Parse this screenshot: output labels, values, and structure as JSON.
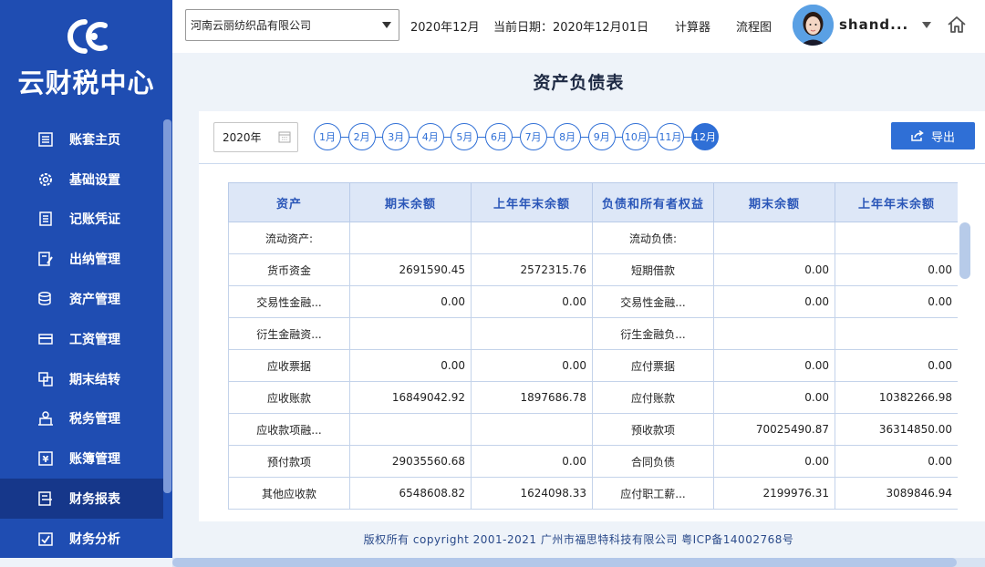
{
  "sidebar": {
    "logo_text": "云财税中心",
    "items": [
      {
        "label": "账套主页",
        "icon": "ledger-home-icon"
      },
      {
        "label": "基础设置",
        "icon": "gear-icon"
      },
      {
        "label": "记账凭证",
        "icon": "voucher-icon"
      },
      {
        "label": "出纳管理",
        "icon": "cashier-icon"
      },
      {
        "label": "资产管理",
        "icon": "assets-icon"
      },
      {
        "label": "工资管理",
        "icon": "card-icon"
      },
      {
        "label": "期末结转",
        "icon": "transfer-icon"
      },
      {
        "label": "税务管理",
        "icon": "tax-icon"
      },
      {
        "label": "账簿管理",
        "icon": "yen-icon"
      },
      {
        "label": "财务报表",
        "icon": "report-icon",
        "active": true
      },
      {
        "label": "财务分析",
        "icon": "analysis-icon"
      }
    ]
  },
  "header": {
    "company": "河南云丽纺织品有限公司",
    "period": "2020年12月",
    "current_date": "当前日期：2020年12月01日",
    "calculator": "计算器",
    "flowchart": "流程图",
    "username": "shand..."
  },
  "page_title": "资产负债表",
  "toolbar": {
    "year": "2020年",
    "months": [
      "1月",
      "2月",
      "3月",
      "4月",
      "5月",
      "6月",
      "7月",
      "8月",
      "9月",
      "10月",
      "11月",
      "12月"
    ],
    "active_month": "12月",
    "export_label": "导出"
  },
  "table": {
    "headers": [
      "资产",
      "期末余额",
      "上年年末余额",
      "负债和所有者权益",
      "期末余额",
      "上年年末余额"
    ],
    "rows": [
      [
        "流动资产:",
        "",
        "",
        "流动负债:",
        "",
        ""
      ],
      [
        "货币资金",
        "2691590.45",
        "2572315.76",
        "短期借款",
        "0.00",
        "0.00"
      ],
      [
        "交易性金融...",
        "0.00",
        "0.00",
        "交易性金融...",
        "0.00",
        "0.00"
      ],
      [
        "衍生金融资...",
        "",
        "",
        "衍生金融负...",
        "",
        ""
      ],
      [
        "应收票据",
        "0.00",
        "0.00",
        "应付票据",
        "0.00",
        "0.00"
      ],
      [
        "应收账款",
        "16849042.92",
        "1897686.78",
        "应付账款",
        "0.00",
        "10382266.98"
      ],
      [
        "应收款项融...",
        "",
        "",
        "预收款项",
        "70025490.87",
        "36314850.00"
      ],
      [
        "预付款项",
        "29035560.68",
        "0.00",
        "合同负债",
        "0.00",
        "0.00"
      ],
      [
        "其他应收款",
        "6548608.82",
        "1624098.33",
        "应付职工薪...",
        "2199976.31",
        "3089846.94"
      ]
    ]
  },
  "footer": "版权所有  copyright   2001-2021  广州市福思特科技有限公司  粤ICP备14002768号",
  "colors": {
    "sidebar": "#1f4db2",
    "sidebar_active": "#16378a",
    "accent": "#2f6fd6",
    "header_cell": "#dde7f7"
  }
}
